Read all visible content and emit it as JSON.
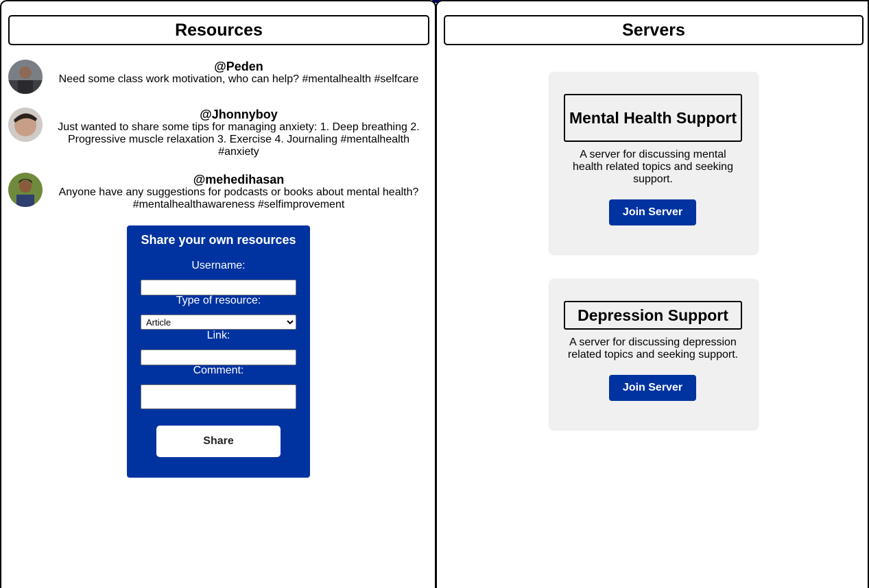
{
  "resources": {
    "title": "Resources",
    "posts": [
      {
        "username": "@Peden",
        "text": "Need some class work motivation, who can help? #mentalhealth #selfcare"
      },
      {
        "username": "@Jhonnyboy",
        "text": "Just wanted to share some tips for managing anxiety: 1. Deep breathing 2. Progressive muscle relaxation 3. Exercise 4. Journaling #mentalhealth #anxiety"
      },
      {
        "username": "@mehedihasan",
        "text": "Anyone have any suggestions for podcasts or books about mental health? #mentalhealthawareness #selfimprovement"
      }
    ],
    "form": {
      "title": "Share your own resources",
      "username_label": "Username:",
      "username_value": "",
      "type_label": "Type of resource:",
      "type_selected": "Article",
      "link_label": "Link:",
      "link_value": "",
      "comment_label": "Comment:",
      "comment_value": "",
      "share_label": "Share"
    }
  },
  "servers": {
    "title": "Servers",
    "items": [
      {
        "name": "Mental Health Support",
        "description": "A server for discussing mental health related topics and seeking support.",
        "button": "Join Server"
      },
      {
        "name": "Depression Support",
        "description": "A server for discussing depression related topics and seeking support.",
        "button": "Join Server"
      }
    ]
  },
  "colors": {
    "accent_blue": "#0033a0",
    "card_bg": "#f0f0f0"
  }
}
